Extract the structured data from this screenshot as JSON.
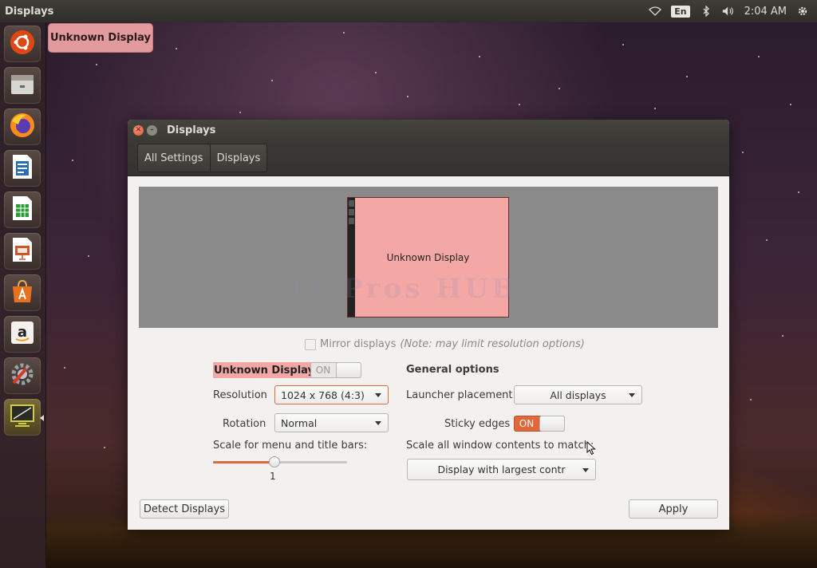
{
  "top_panel": {
    "app_title": "Displays",
    "keyboard_layout": "En",
    "clock": "2:04 AM"
  },
  "launcher": {
    "items": [
      {
        "icon": "ubuntu-dash-icon"
      },
      {
        "icon": "file-manager-icon"
      },
      {
        "icon": "firefox-icon"
      },
      {
        "icon": "libreoffice-writer-icon"
      },
      {
        "icon": "libreoffice-calc-icon"
      },
      {
        "icon": "libreoffice-impress-icon"
      },
      {
        "icon": "ubuntu-software-center-icon"
      },
      {
        "icon": "amazon-icon"
      },
      {
        "icon": "system-settings-icon"
      },
      {
        "icon": "displays-icon",
        "active": true
      }
    ]
  },
  "tooltip": {
    "text": "Unknown Display"
  },
  "window": {
    "title": "Displays",
    "breadcrumbs": [
      "All Settings",
      "Displays"
    ],
    "preview": {
      "monitor_label": "Unknown Display",
      "watermark": "IT Pros HUB"
    },
    "mirror": {
      "label": "Mirror displays",
      "note": "(Note: may limit resolution options)",
      "checked": false,
      "enabled": false
    },
    "display": {
      "name": "Unknown Display",
      "power_switch": "ON",
      "resolution_label": "Resolution",
      "resolution_value": "1024 x 768 (4:3)",
      "rotation_label": "Rotation",
      "rotation_value": "Normal",
      "scale_label": "Scale for menu and title bars:",
      "scale_value": "1",
      "scale_fraction": 0.45
    },
    "general": {
      "heading": "General options",
      "launcher_placement_label": "Launcher placement",
      "launcher_placement_value": "All displays",
      "sticky_edges_label": "Sticky edges",
      "sticky_edges_switch": "ON",
      "scale_all_label": "Scale all window contents to match:",
      "scale_all_value": "Display with largest contr"
    },
    "buttons": {
      "detect": "Detect Displays",
      "apply": "Apply"
    }
  },
  "colors": {
    "accent": "#e0683a",
    "highlight": "#f3a7a6"
  }
}
